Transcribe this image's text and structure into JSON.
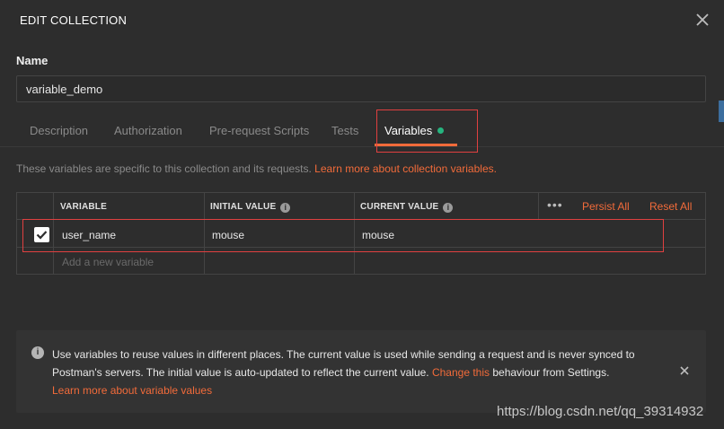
{
  "header": {
    "title": "EDIT COLLECTION"
  },
  "name": {
    "label": "Name",
    "value": "variable_demo"
  },
  "tabs": [
    {
      "label": "Description"
    },
    {
      "label": "Authorization"
    },
    {
      "label": "Pre-request Scripts"
    },
    {
      "label": "Tests"
    },
    {
      "label": "Variables",
      "active": true
    }
  ],
  "description": {
    "text": "These variables are specific to this collection and its requests.",
    "link": "Learn more about collection variables."
  },
  "table": {
    "headers": {
      "variable": "VARIABLE",
      "initial": "INITIAL VALUE",
      "current": "CURRENT VALUE"
    },
    "more": "•••",
    "persist_all": "Persist All",
    "reset_all": "Reset All",
    "rows": [
      {
        "checked": true,
        "variable": "user_name",
        "initial": "mouse",
        "current": "mouse"
      }
    ],
    "new_placeholder": "Add a new variable"
  },
  "notice": {
    "text1": "Use variables to reuse values in different places. The current value is used while sending a request and is never synced to Postman's servers. The initial value is auto-updated to reflect the current value.",
    "change_link": "Change this",
    "text2": "behaviour from Settings.",
    "learn_link": "Learn more about variable values"
  },
  "watermark": "https://blog.csdn.net/qq_39314932",
  "colors": {
    "accent": "#f26b3a",
    "status_dot": "#26b47f",
    "highlight": "#e04040",
    "background": "#2d2d2d"
  }
}
